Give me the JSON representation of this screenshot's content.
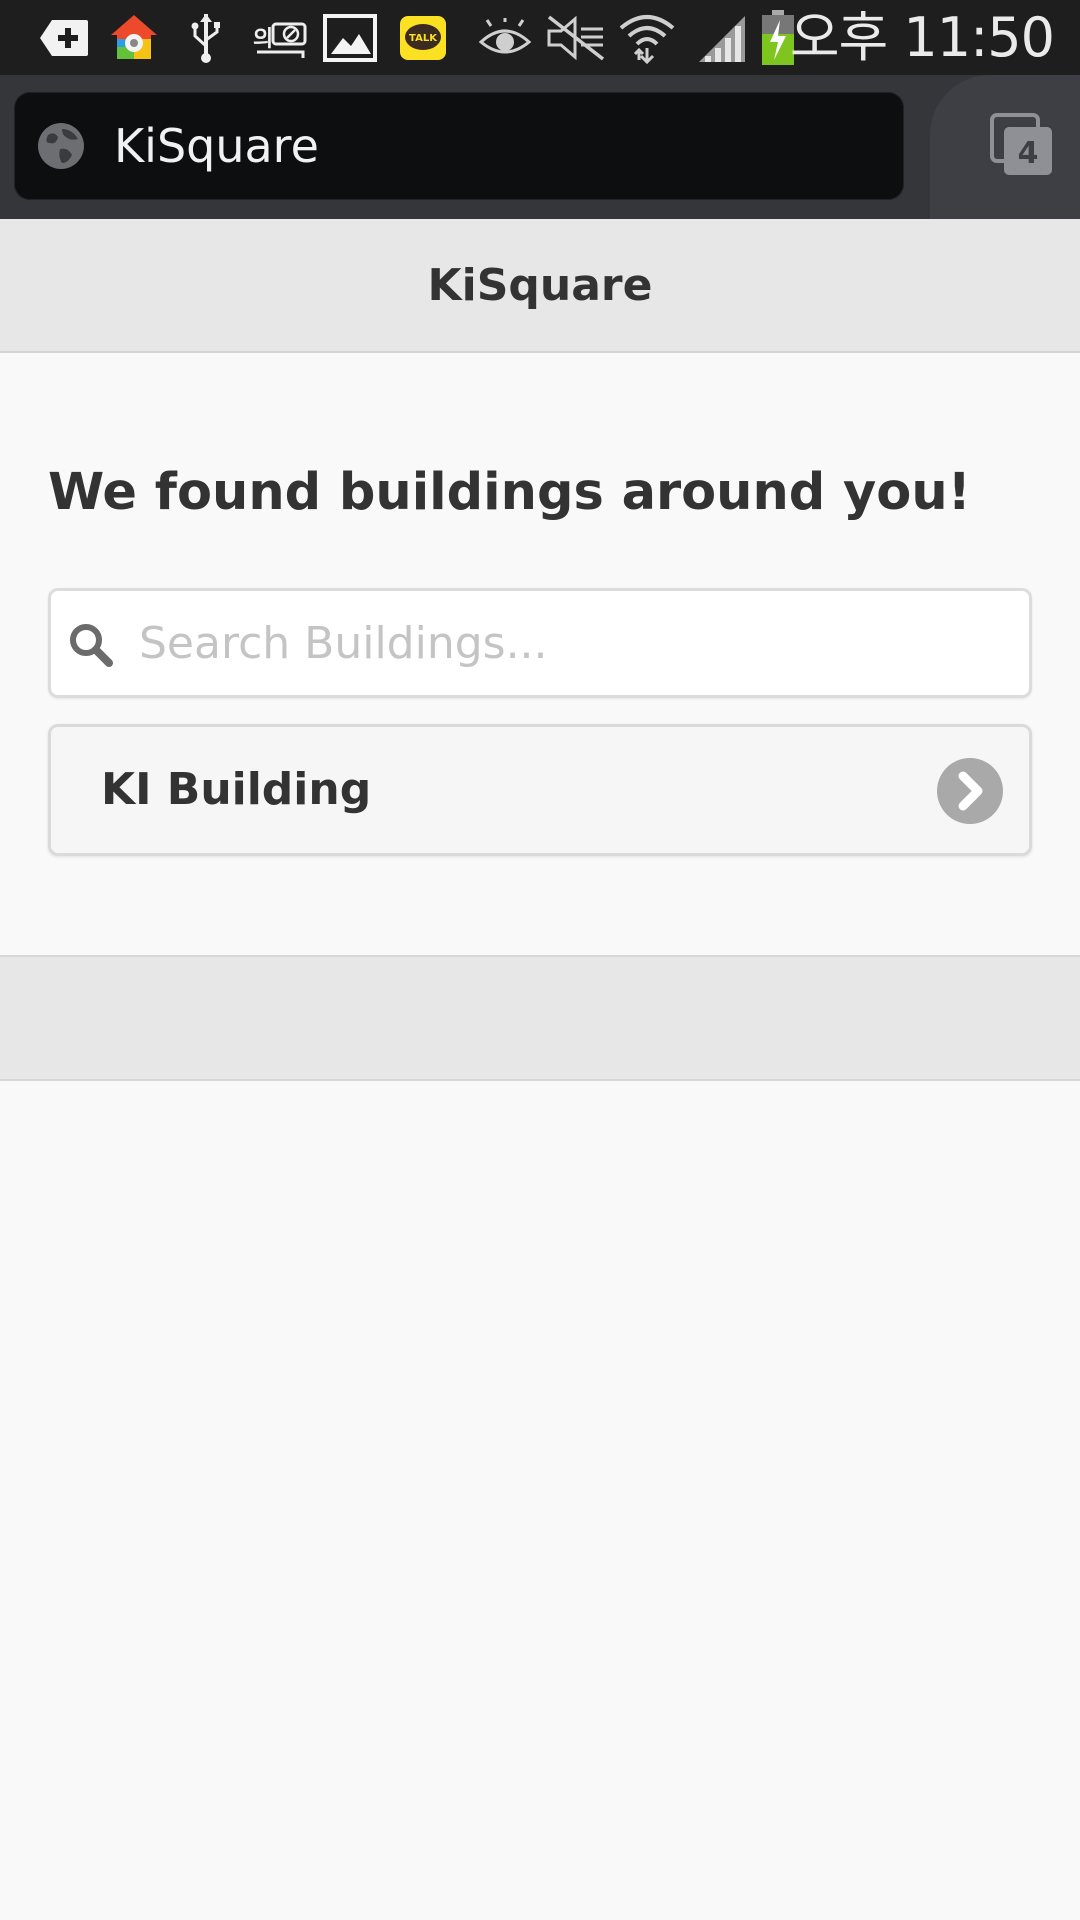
{
  "status_bar": {
    "time": "오후 11:50",
    "icons": [
      "plus-notification-icon",
      "settings-app-icon",
      "usb-icon",
      "signal-app-icon",
      "gallery-icon",
      "kakaotalk-icon",
      "eye-icon",
      "mute-icon",
      "wifi-icon",
      "cell-signal-icon",
      "battery-charging-icon"
    ],
    "kakao_label": "TALK"
  },
  "browser": {
    "url": "KiSquare",
    "tab_count": "4"
  },
  "app": {
    "title": "KiSquare"
  },
  "main": {
    "headline": "We found buildings around you!",
    "search": {
      "placeholder": "Search Buildings...",
      "value": ""
    },
    "buildings": [
      {
        "label": "KI Building"
      }
    ]
  },
  "colors": {
    "status_bg": "#1e1e1e",
    "browser_bg": "#34363a",
    "header_bg": "#e7e7e7",
    "content_bg": "#f9f9f9",
    "text_dark": "#333333",
    "chevron_bg": "#a9a9a9"
  }
}
